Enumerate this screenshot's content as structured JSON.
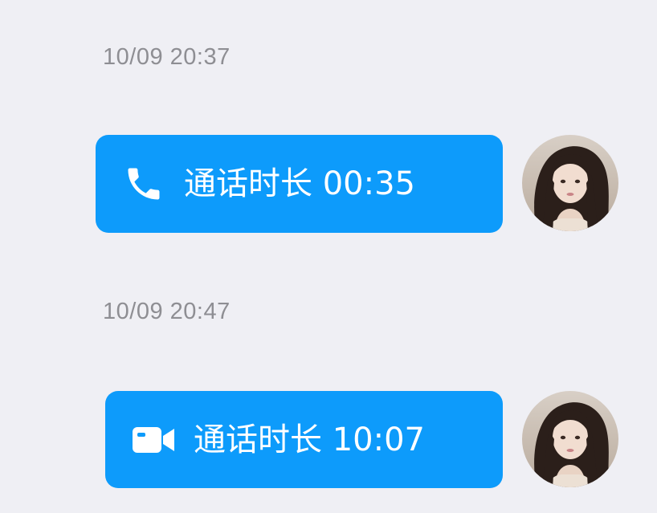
{
  "messages": [
    {
      "timestamp": "10/09 20:37",
      "call_type": "voice",
      "icon": "phone-icon",
      "label": "通话时长 00:35"
    },
    {
      "timestamp": "10/09 20:47",
      "call_type": "video",
      "icon": "video-camera-icon",
      "label": "通话时长 10:07"
    }
  ],
  "colors": {
    "background": "#efeff4",
    "bubble": "#0d9bfb",
    "bubble_text": "#ffffff",
    "timestamp_text": "#8e8e93"
  }
}
